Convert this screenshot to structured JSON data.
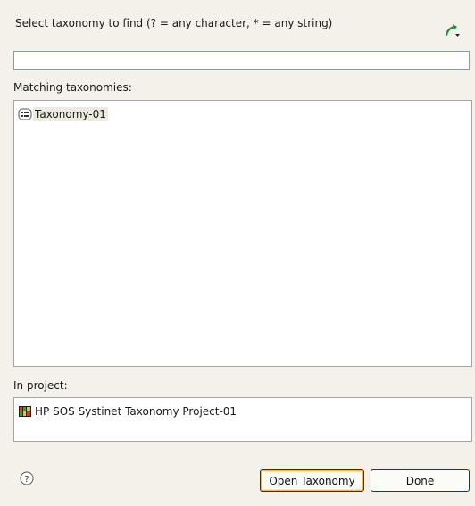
{
  "header": {
    "title": "Select taxonomy to find (? = any character, * = any string)",
    "menu_icon": "dropdown-menu-icon"
  },
  "search": {
    "value": "",
    "placeholder": ""
  },
  "matching": {
    "label": "Matching taxonomies:",
    "items": [
      {
        "label": "Taxonomy-01",
        "icon": "taxonomy-icon",
        "selected": true
      }
    ]
  },
  "project": {
    "label": "In project:",
    "items": [
      {
        "label": "HP SOS Systinet Taxonomy Project-01",
        "icon": "project-icon"
      }
    ]
  },
  "footer": {
    "help_icon": "help-icon",
    "open_label": "Open Taxonomy",
    "done_label": "Done"
  },
  "colors": {
    "background": "#f3f1ea",
    "focus_border": "#f8b347",
    "arrow_green": "#2a8a3e"
  }
}
